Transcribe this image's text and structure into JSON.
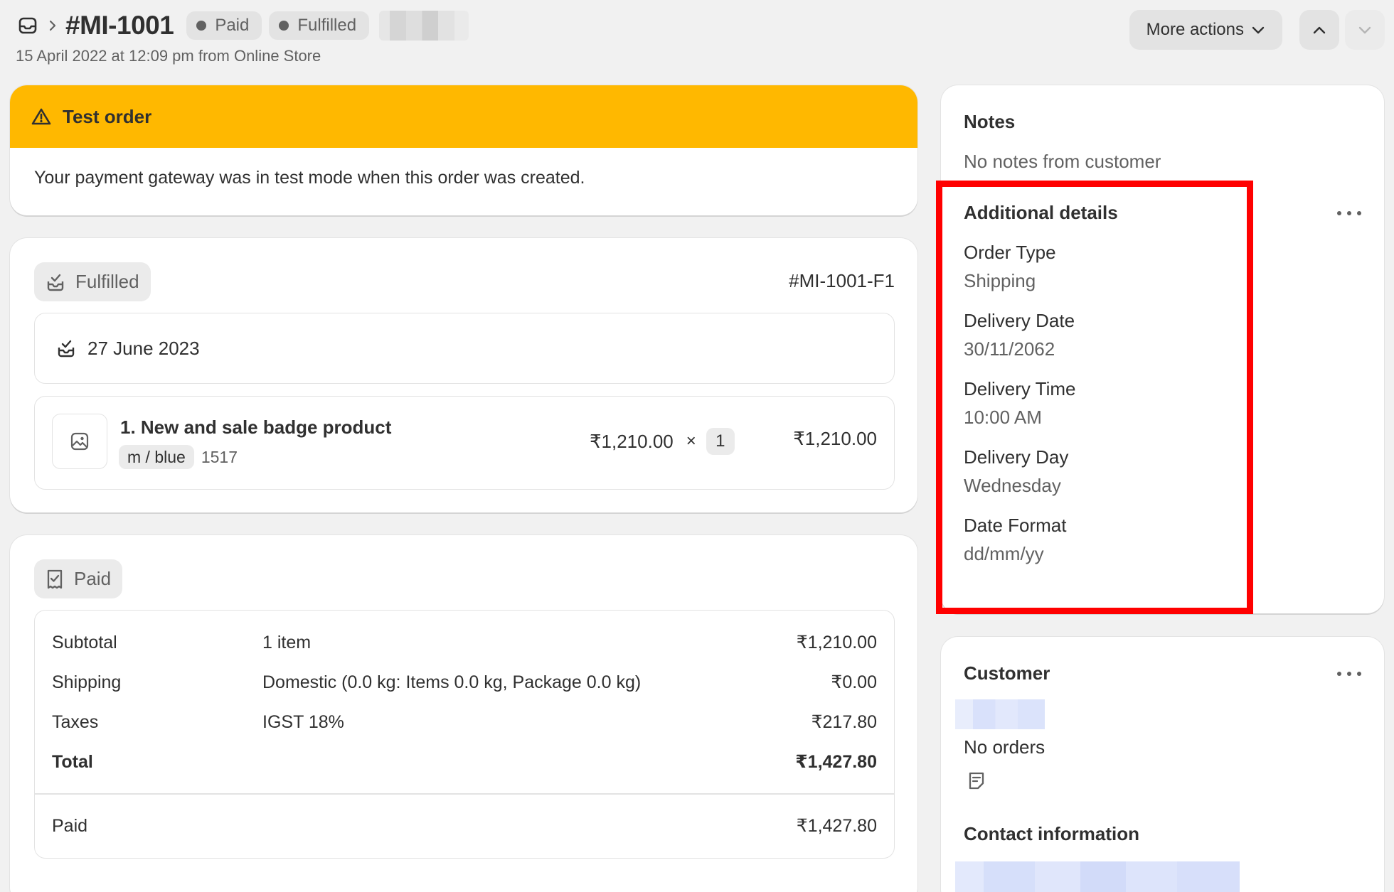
{
  "header": {
    "order_number": "#MI-1001",
    "badges": [
      "Paid",
      "Fulfilled"
    ],
    "subtitle": "15 April 2022 at 12:09 pm from Online Store",
    "more_actions": "More actions"
  },
  "test_order": {
    "title": "Test order",
    "message": "Your payment gateway was in test mode when this order was created."
  },
  "fulfillment": {
    "status": "Fulfilled",
    "id": "#MI-1001-F1",
    "date": "27 June 2023",
    "item": {
      "title": "1. New and sale badge product",
      "variant": "m / blue",
      "sku": "1517",
      "unit_price": "₹1,210.00",
      "times": "×",
      "quantity": "1",
      "total": "₹1,210.00"
    }
  },
  "payment": {
    "status": "Paid",
    "rows": [
      {
        "label": "Subtotal",
        "desc": "1 item",
        "amount": "₹1,210.00"
      },
      {
        "label": "Shipping",
        "desc": "Domestic (0.0 kg: Items 0.0 kg, Package 0.0 kg)",
        "amount": "₹0.00"
      },
      {
        "label": "Taxes",
        "desc": "IGST 18%",
        "amount": "₹217.80"
      },
      {
        "label": "Total",
        "desc": "",
        "amount": "₹1,427.80"
      }
    ],
    "paid": {
      "label": "Paid",
      "amount": "₹1,427.80"
    }
  },
  "notes": {
    "title": "Notes",
    "text": "No notes from customer"
  },
  "additional_details": {
    "title": "Additional details",
    "items": [
      {
        "key": "Order Type",
        "value": "Shipping"
      },
      {
        "key": "Delivery Date",
        "value": "30/11/2062"
      },
      {
        "key": "Delivery Time",
        "value": "10:00 AM"
      },
      {
        "key": "Delivery Day",
        "value": "Wednesday"
      },
      {
        "key": "Date Format",
        "value": "dd/mm/yy"
      }
    ]
  },
  "customer": {
    "title": "Customer",
    "orders": "No orders",
    "contact_title": "Contact information"
  },
  "colors": {
    "warning": "#ffb800",
    "highlight": "#ff0000",
    "badge_bg": "#e3e3e3"
  }
}
